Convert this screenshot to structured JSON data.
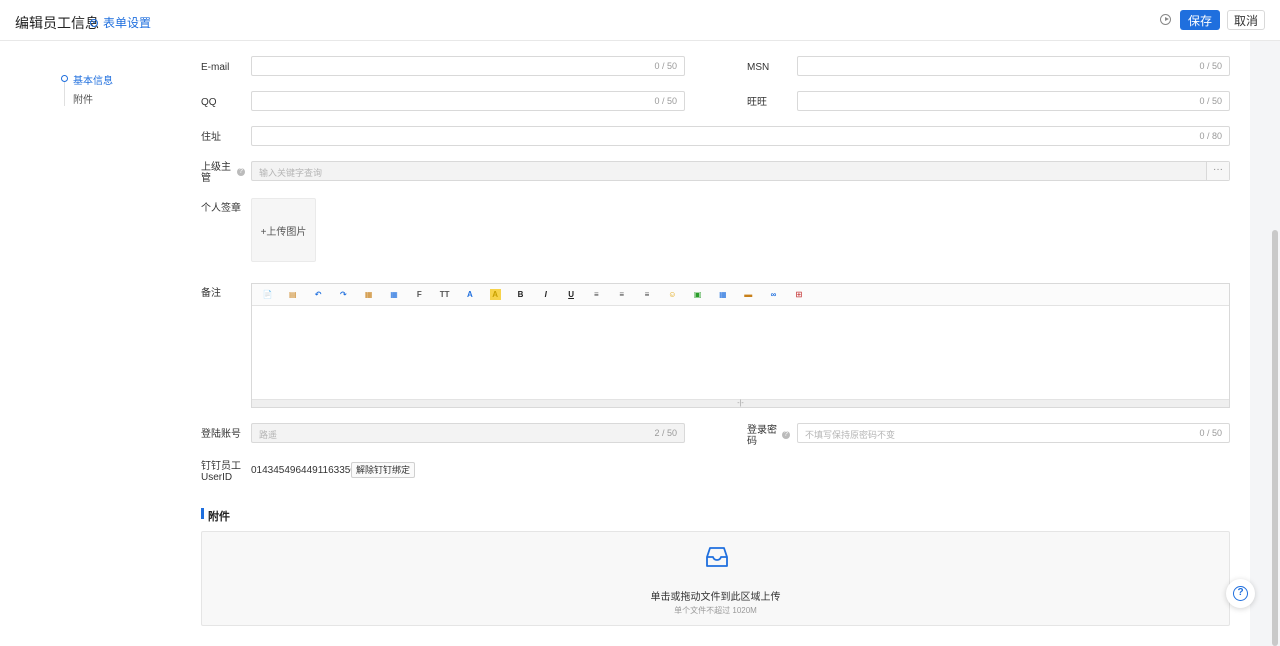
{
  "header": {
    "title": "编辑员工信息",
    "form_settings": "表单设置",
    "save": "保存",
    "cancel": "取消"
  },
  "anchor_nav": {
    "items": [
      "基本信息",
      "附件"
    ]
  },
  "fields": {
    "email": {
      "label": "E-mail",
      "count": "0 / 50"
    },
    "msn": {
      "label": "MSN",
      "count": "0 / 50"
    },
    "qq": {
      "label": "QQ",
      "count": "0 / 50"
    },
    "wangwang": {
      "label": "旺旺",
      "count": "0 / 50"
    },
    "address": {
      "label": "住址",
      "count": "0 / 80"
    },
    "supervisor": {
      "label": "上级主管",
      "placeholder": "输入关键字查询",
      "more": "···"
    },
    "signature": {
      "label": "个人签章",
      "upload": "+上传图片"
    },
    "remark": {
      "label": "备注"
    },
    "login_account": {
      "label": "登陆账号",
      "value": "路遥",
      "count": "2 / 50"
    },
    "login_password": {
      "label": "登录密码",
      "placeholder": "不填写保持原密码不变",
      "count": "0 / 50"
    },
    "dingtalk": {
      "label": "钉钉员工UserID",
      "value": "0143454964491163350",
      "unbind": "解除钉钉绑定"
    }
  },
  "editor_toolbar": [
    {
      "icon": "source-icon",
      "glyph": "📄"
    },
    {
      "icon": "template-icon",
      "glyph": "▤"
    },
    {
      "icon": "undo-icon",
      "glyph": "↶"
    },
    {
      "icon": "redo-icon",
      "glyph": "↷"
    },
    {
      "icon": "paste-icon",
      "glyph": "▦"
    },
    {
      "icon": "paste-word-icon",
      "glyph": "▦"
    },
    {
      "icon": "font-family-icon",
      "glyph": "F"
    },
    {
      "icon": "font-size-icon",
      "glyph": "TT"
    },
    {
      "icon": "font-color-icon",
      "glyph": "A"
    },
    {
      "icon": "highlight-icon",
      "glyph": "A"
    },
    {
      "icon": "bold-icon",
      "glyph": "B"
    },
    {
      "icon": "italic-icon",
      "glyph": "I"
    },
    {
      "icon": "underline-icon",
      "glyph": "U"
    },
    {
      "icon": "align-left-icon",
      "glyph": "≡"
    },
    {
      "icon": "align-center-icon",
      "glyph": "≡"
    },
    {
      "icon": "align-right-icon",
      "glyph": "≡"
    },
    {
      "icon": "emoji-icon",
      "glyph": "☺"
    },
    {
      "icon": "insert-image-icon",
      "glyph": "▣"
    },
    {
      "icon": "table-icon",
      "glyph": "▦"
    },
    {
      "icon": "media-icon",
      "glyph": "▬"
    },
    {
      "icon": "link-icon",
      "glyph": "∞"
    },
    {
      "icon": "fullscreen-icon",
      "glyph": "⊞"
    }
  ],
  "attachments": {
    "section_title": "附件",
    "drop_main": "单击或拖动文件到此区域上传",
    "drop_sub": "单个文件不超过 1020M"
  },
  "colors": {
    "primary": "#1f6fde",
    "border": "#d9d9d9",
    "background": "#f4f5f7"
  }
}
